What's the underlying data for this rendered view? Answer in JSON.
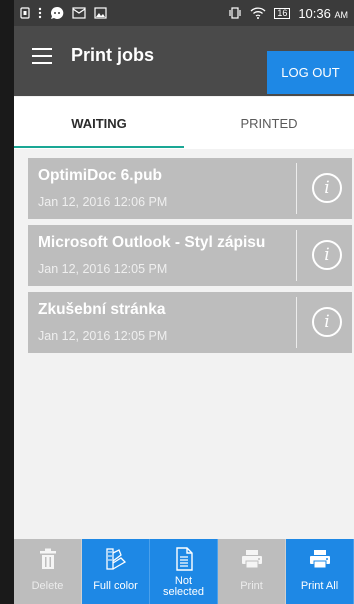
{
  "status_bar": {
    "time": "10:36",
    "ampm": "AM",
    "battery": "16"
  },
  "app_bar": {
    "title": "Print jobs",
    "logout_label": "LOG OUT"
  },
  "tabs": [
    {
      "label": "WAITING",
      "active": true
    },
    {
      "label": "PRINTED",
      "active": false
    }
  ],
  "jobs": [
    {
      "name": "OptimiDoc 6.pub",
      "date": "Jan 12, 2016 12:06 PM"
    },
    {
      "name": "Microsoft Outlook - Styl zápisu",
      "date": "Jan 12, 2016 12:05 PM"
    },
    {
      "name": "Zkušební stránka",
      "date": "Jan 12, 2016 12:05 PM"
    }
  ],
  "toolbar": {
    "delete": "Delete",
    "full_color": "Full color",
    "not_selected_line1": "Not",
    "not_selected_line2": "selected",
    "print": "Print",
    "print_all": "Print All"
  },
  "colors": {
    "accent": "#1aa795",
    "primary_blue": "#1e88e5",
    "app_bar": "#4a4a4a",
    "job_card": "#bdbdbd"
  },
  "icons": {
    "job_info": "info-icon",
    "delete": "trash-icon",
    "full_color": "color-palette-icon",
    "not_selected": "document-icon",
    "print": "printer-icon",
    "print_all": "printer-icon"
  }
}
